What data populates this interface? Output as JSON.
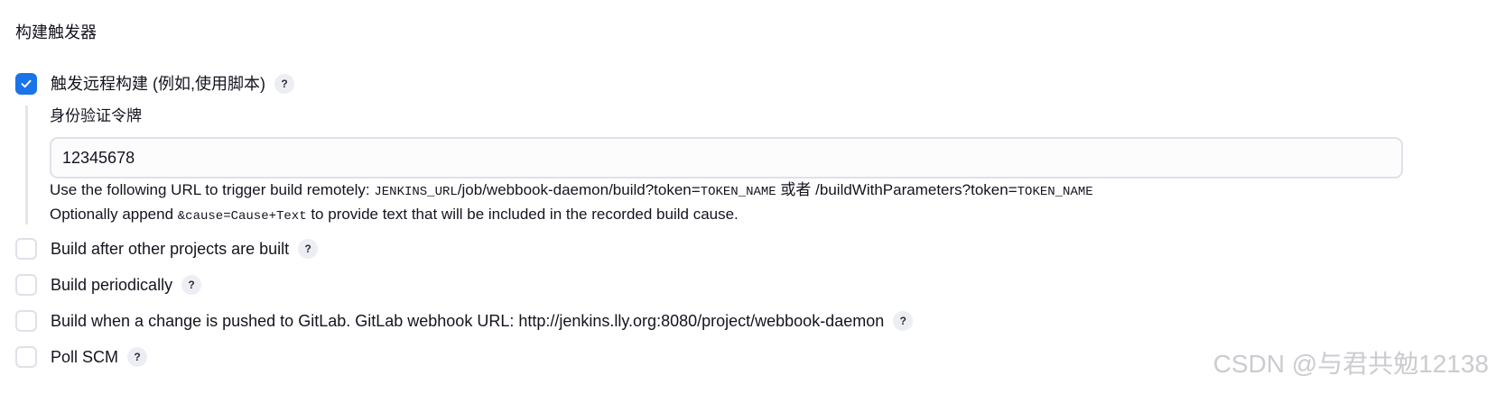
{
  "section": {
    "title": "构建触发器"
  },
  "remote_trigger": {
    "checked": true,
    "label": "触发远程构建 (例如,使用脚本)",
    "help": "?",
    "token_label": "身份验证令牌",
    "token_value": "12345678",
    "url_line": {
      "prefix": "Use the following URL to trigger build remotely: ",
      "jenkins_url": "JENKINS_URL",
      "path": "/job/webbook-daemon/build?token=",
      "token_name": "TOKEN_NAME",
      "or_text": " 或者 ",
      "alt_path": "/buildWithParameters?token=",
      "token_name_2": "TOKEN_NAME"
    },
    "cause_line": {
      "prefix": "Optionally append ",
      "code": "&cause=Cause+Text",
      "suffix": " to provide text that will be included in the recorded build cause."
    }
  },
  "options": [
    {
      "label": "Build after other projects are built",
      "checked": false,
      "help": "?"
    },
    {
      "label": "Build periodically",
      "checked": false,
      "help": "?"
    },
    {
      "label": "Build when a change is pushed to GitLab. GitLab webhook URL: http://jenkins.lly.org:8080/project/webbook-daemon",
      "checked": false,
      "help": "?"
    },
    {
      "label": "Poll SCM",
      "checked": false,
      "help": "?"
    }
  ],
  "watermark": "CSDN @与君共勉12138",
  "colors": {
    "accent": "#1a73e8",
    "help_bg": "#eceef3",
    "border": "#dfe1e9"
  },
  "icons": {
    "checkmark": "check-icon",
    "help": "help-icon"
  }
}
